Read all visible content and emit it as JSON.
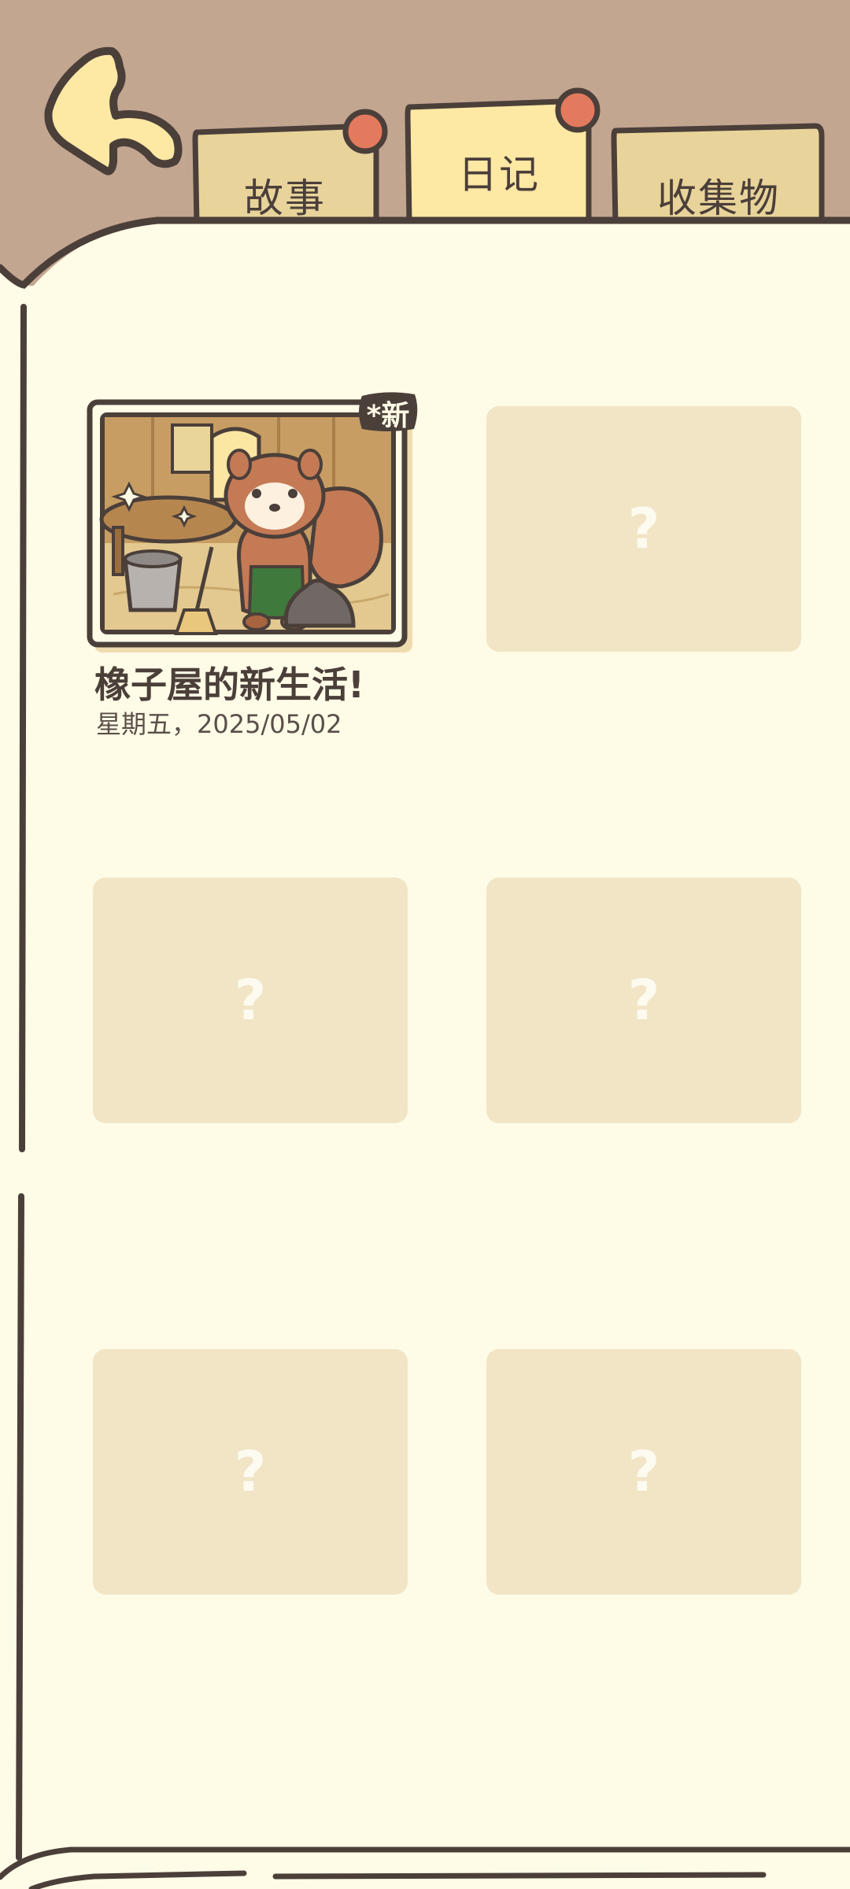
{
  "tabs": [
    {
      "label": "故事",
      "has_notification": true,
      "active": false
    },
    {
      "label": "日记",
      "has_notification": true,
      "active": true
    },
    {
      "label": "收集物",
      "has_notification": false,
      "active": false
    }
  ],
  "diary": {
    "badge": "*新",
    "title": "橡子屋的新生活!",
    "date": "星期五，2025/05/02"
  },
  "slots": [
    {
      "symbol": "?"
    },
    {
      "symbol": "?"
    },
    {
      "symbol": "?"
    },
    {
      "symbol": "?"
    },
    {
      "symbol": "?"
    }
  ],
  "colors": {
    "background_top": "#c3a690",
    "page": "#fefbe6",
    "outline": "#4b3f3a",
    "tab_inactive": "#e8d49a",
    "tab_active": "#fde8a4",
    "notification_dot": "#e37a5d",
    "slot": "#f1e5c6"
  }
}
